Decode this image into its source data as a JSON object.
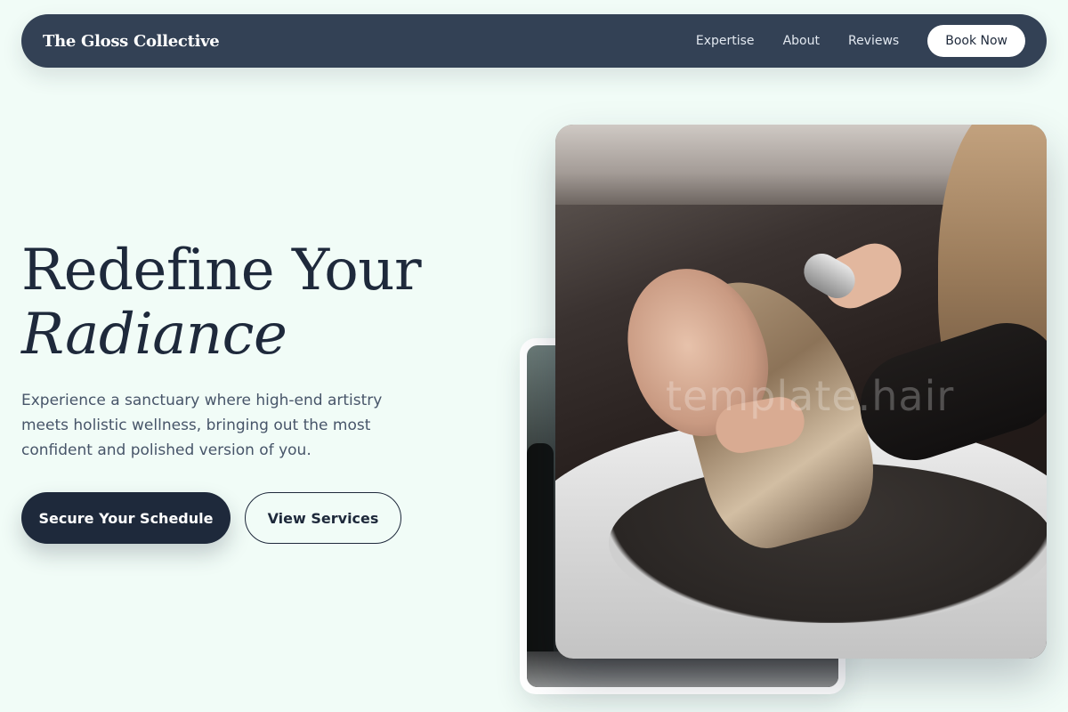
{
  "nav": {
    "brand": "The Gloss Collective",
    "links": [
      "Expertise",
      "About",
      "Reviews"
    ],
    "cta": "Book Now"
  },
  "hero": {
    "title_line1": "Redefine Your",
    "title_line2": "Radiance",
    "description": "Experience a sanctuary where high-end artistry meets holistic wellness, bringing out the most confident and polished version of you.",
    "primary_button": "Secure Your Schedule",
    "secondary_button": "View Services"
  },
  "image": {
    "watermark": "template.hair"
  },
  "colors": {
    "background": "#f1fcf7",
    "nav_bg": "#334155",
    "primary": "#1e293b",
    "text_muted": "#475569"
  }
}
